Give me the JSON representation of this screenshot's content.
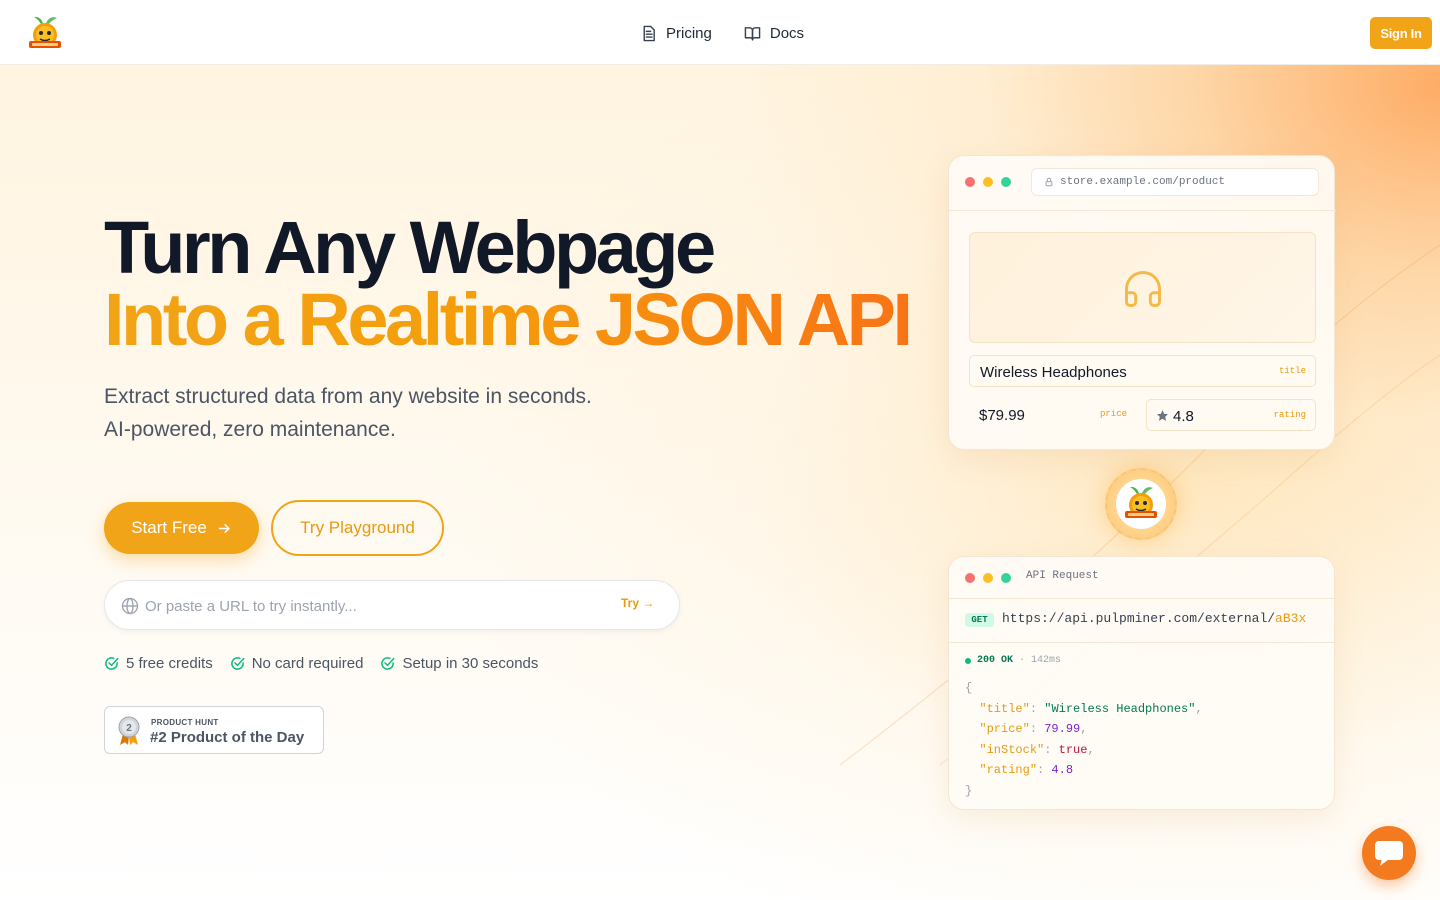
{
  "nav": {
    "logo_icon": "pulpminer-logo-icon",
    "links": [
      {
        "label": "Pricing",
        "icon": "document-icon"
      },
      {
        "label": "Docs",
        "icon": "book-icon"
      }
    ],
    "signin_label": "Sign In"
  },
  "hero": {
    "title_line1": "Turn Any Webpage",
    "title_line2": "Into a Realtime JSON API",
    "subtitle_line1": "Extract structured data from any website in seconds.",
    "subtitle_line2": "AI-powered, zero maintenance.",
    "cta_primary": "Start Free",
    "cta_secondary": "Try Playground",
    "url_placeholder": "Or paste a URL to try instantly...",
    "url_try": "Try →",
    "checks": [
      "5 free credits",
      "No card required",
      "Setup in 30 seconds"
    ],
    "product_hunt": {
      "small": "PRODUCT HUNT",
      "big": "#2 Product of the Day",
      "rank": "2"
    }
  },
  "preview": {
    "address": "store.example.com/product",
    "title_value": "Wireless Headphones",
    "title_label": "title",
    "price_value": "$79.99",
    "price_label": "price",
    "rating_value": "4.8",
    "rating_label": "rating"
  },
  "api": {
    "title": "API Request",
    "method": "GET",
    "url_base": "https://api.pulpminer.com/external/",
    "url_key": "aB3x",
    "status": "200 OK",
    "time": "142ms",
    "response": {
      "title": "Wireless Headphones",
      "price": "79.99",
      "inStock": "true",
      "rating": "4.8"
    }
  },
  "colors": {
    "accent": "#f1a417",
    "accent_dark": "#f97316",
    "text_dark": "#111827",
    "success": "#10b981"
  }
}
